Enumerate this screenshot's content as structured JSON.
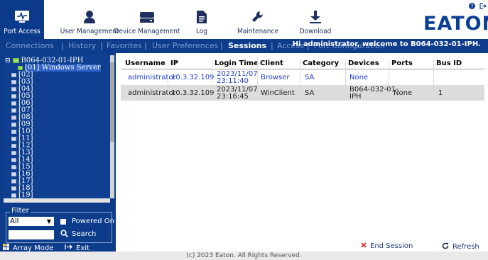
{
  "toolbar": {
    "items": [
      {
        "label": "Port Access",
        "icon": "port-access-icon"
      },
      {
        "label": "User Management",
        "icon": "user-icon"
      },
      {
        "label": "Device Management",
        "icon": "device-icon"
      },
      {
        "label": "Log",
        "icon": "log-icon"
      },
      {
        "label": "Maintenance",
        "icon": "wrench-icon"
      },
      {
        "label": "Download",
        "icon": "download-icon"
      }
    ],
    "help_icon": "help-icon",
    "logout_icon": "logout-icon",
    "brand": "EATON",
    "brand_mark": "®"
  },
  "nav": {
    "items": [
      "Connections",
      "History",
      "Favorites",
      "User Preferences",
      "Sessions",
      "Access",
      "Port Configuration"
    ],
    "active": "Sessions",
    "welcome": "Hi administrator, welcome to B064-032-01-IPH."
  },
  "tree": {
    "root": "B064-032-01-IPH",
    "ports": [
      "[01] Windows Server",
      "[02]",
      "[03]",
      "[04]",
      "[05]",
      "[06]",
      "[07]",
      "[08]",
      "[09]",
      "[10]",
      "[11]",
      "[12]",
      "[13]",
      "[14]",
      "[15]",
      "[16]",
      "[17]",
      "[18]",
      "[19]"
    ]
  },
  "filter": {
    "legend": "Filter",
    "select_value": "All",
    "powered_on_label": "Powered On",
    "search_label": "Search"
  },
  "left_actions": {
    "array_mode": "Array Mode",
    "exit": "Exit"
  },
  "sessions": {
    "headers": [
      "Username",
      "IP",
      "Login Time",
      "Client",
      "Category",
      "Devices",
      "Ports",
      "Bus ID"
    ],
    "rows": [
      {
        "username": "administrator",
        "ip": "10.3.32.109",
        "login_date": "2023/11/07",
        "login_clock": "23:11:40",
        "client": "Browser",
        "category": "SA",
        "devices": "None",
        "devices_2": "",
        "ports": "",
        "bus_id": ""
      },
      {
        "username": "administrator",
        "ip": "10.3.32.109",
        "login_date": "2023/11/07",
        "login_clock": "23:16:45",
        "client": "WinClient",
        "category": "SA",
        "devices": "B064-032-01-",
        "devices_2": "IPH",
        "ports": "None",
        "bus_id": "1"
      }
    ]
  },
  "actions": {
    "end_session": "End Session",
    "refresh": "Refresh"
  },
  "footer": "(c) 2023 Eaton. All Rights Reserved.",
  "colors": {
    "brand_blue": "#0a3f94",
    "nav_bg": "#0d3c8b",
    "selected_row": "#dcdcdc",
    "link_blue": "#1f3fcf",
    "end_red": "#d62020"
  }
}
